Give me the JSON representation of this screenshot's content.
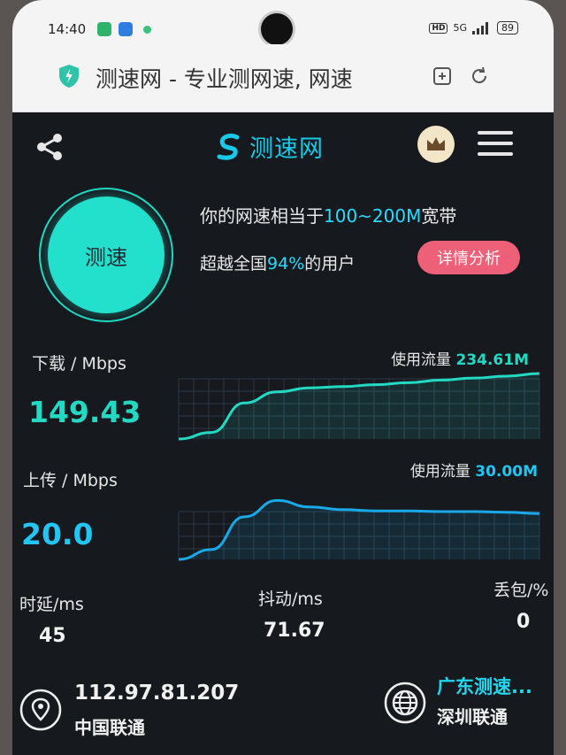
{
  "status_bar": {
    "time": "14:40",
    "network": "5G",
    "battery": "89",
    "hd": "HD"
  },
  "browser": {
    "page_title": "测速网 - 专业测网速, 网速"
  },
  "header": {
    "logo_text": "测速网"
  },
  "test": {
    "button_label": "测速",
    "summary_prefix": "你的网速相当于",
    "summary_range": "100~200M",
    "summary_suffix": "宽带",
    "beat_prefix": "超越全国",
    "beat_percent": "94%",
    "beat_suffix": "的用户",
    "detail_button": "详情分析"
  },
  "download": {
    "label": "下载 / Mbps",
    "value": "149.43",
    "usage_label": "使用流量",
    "usage_value": "234.61M"
  },
  "upload": {
    "label": "上传 / Mbps",
    "value": "20.0",
    "usage_label": "使用流量",
    "usage_value": "30.00M"
  },
  "stats": {
    "latency_label": "时延/ms",
    "latency_value": "45",
    "jitter_label": "抖动/ms",
    "jitter_value": "71.67",
    "loss_label": "丢包/%",
    "loss_value": "0"
  },
  "footer": {
    "ip": "112.97.81.207",
    "isp": "中国联通",
    "node": "广东测速...",
    "node_isp": "深圳联通"
  },
  "colors": {
    "accent": "#19c9e8",
    "button": "#22e0cc",
    "detail": "#ee5f78",
    "download_line": "#23d9c4",
    "upload_line": "#1aa9e8"
  },
  "chart_data": [
    {
      "type": "area",
      "series": [
        {
          "name": "下载",
          "values": [
            0,
            0.1,
            0.55,
            0.72,
            0.78,
            0.8,
            0.83,
            0.86,
            0.9,
            0.93,
            0.96,
            1.0
          ]
        }
      ]
    },
    {
      "type": "area",
      "series": [
        {
          "name": "上传",
          "values": [
            0,
            0.15,
            0.65,
            0.9,
            0.8,
            0.76,
            0.74,
            0.74,
            0.73,
            0.73,
            0.72,
            0.7
          ]
        }
      ]
    }
  ]
}
